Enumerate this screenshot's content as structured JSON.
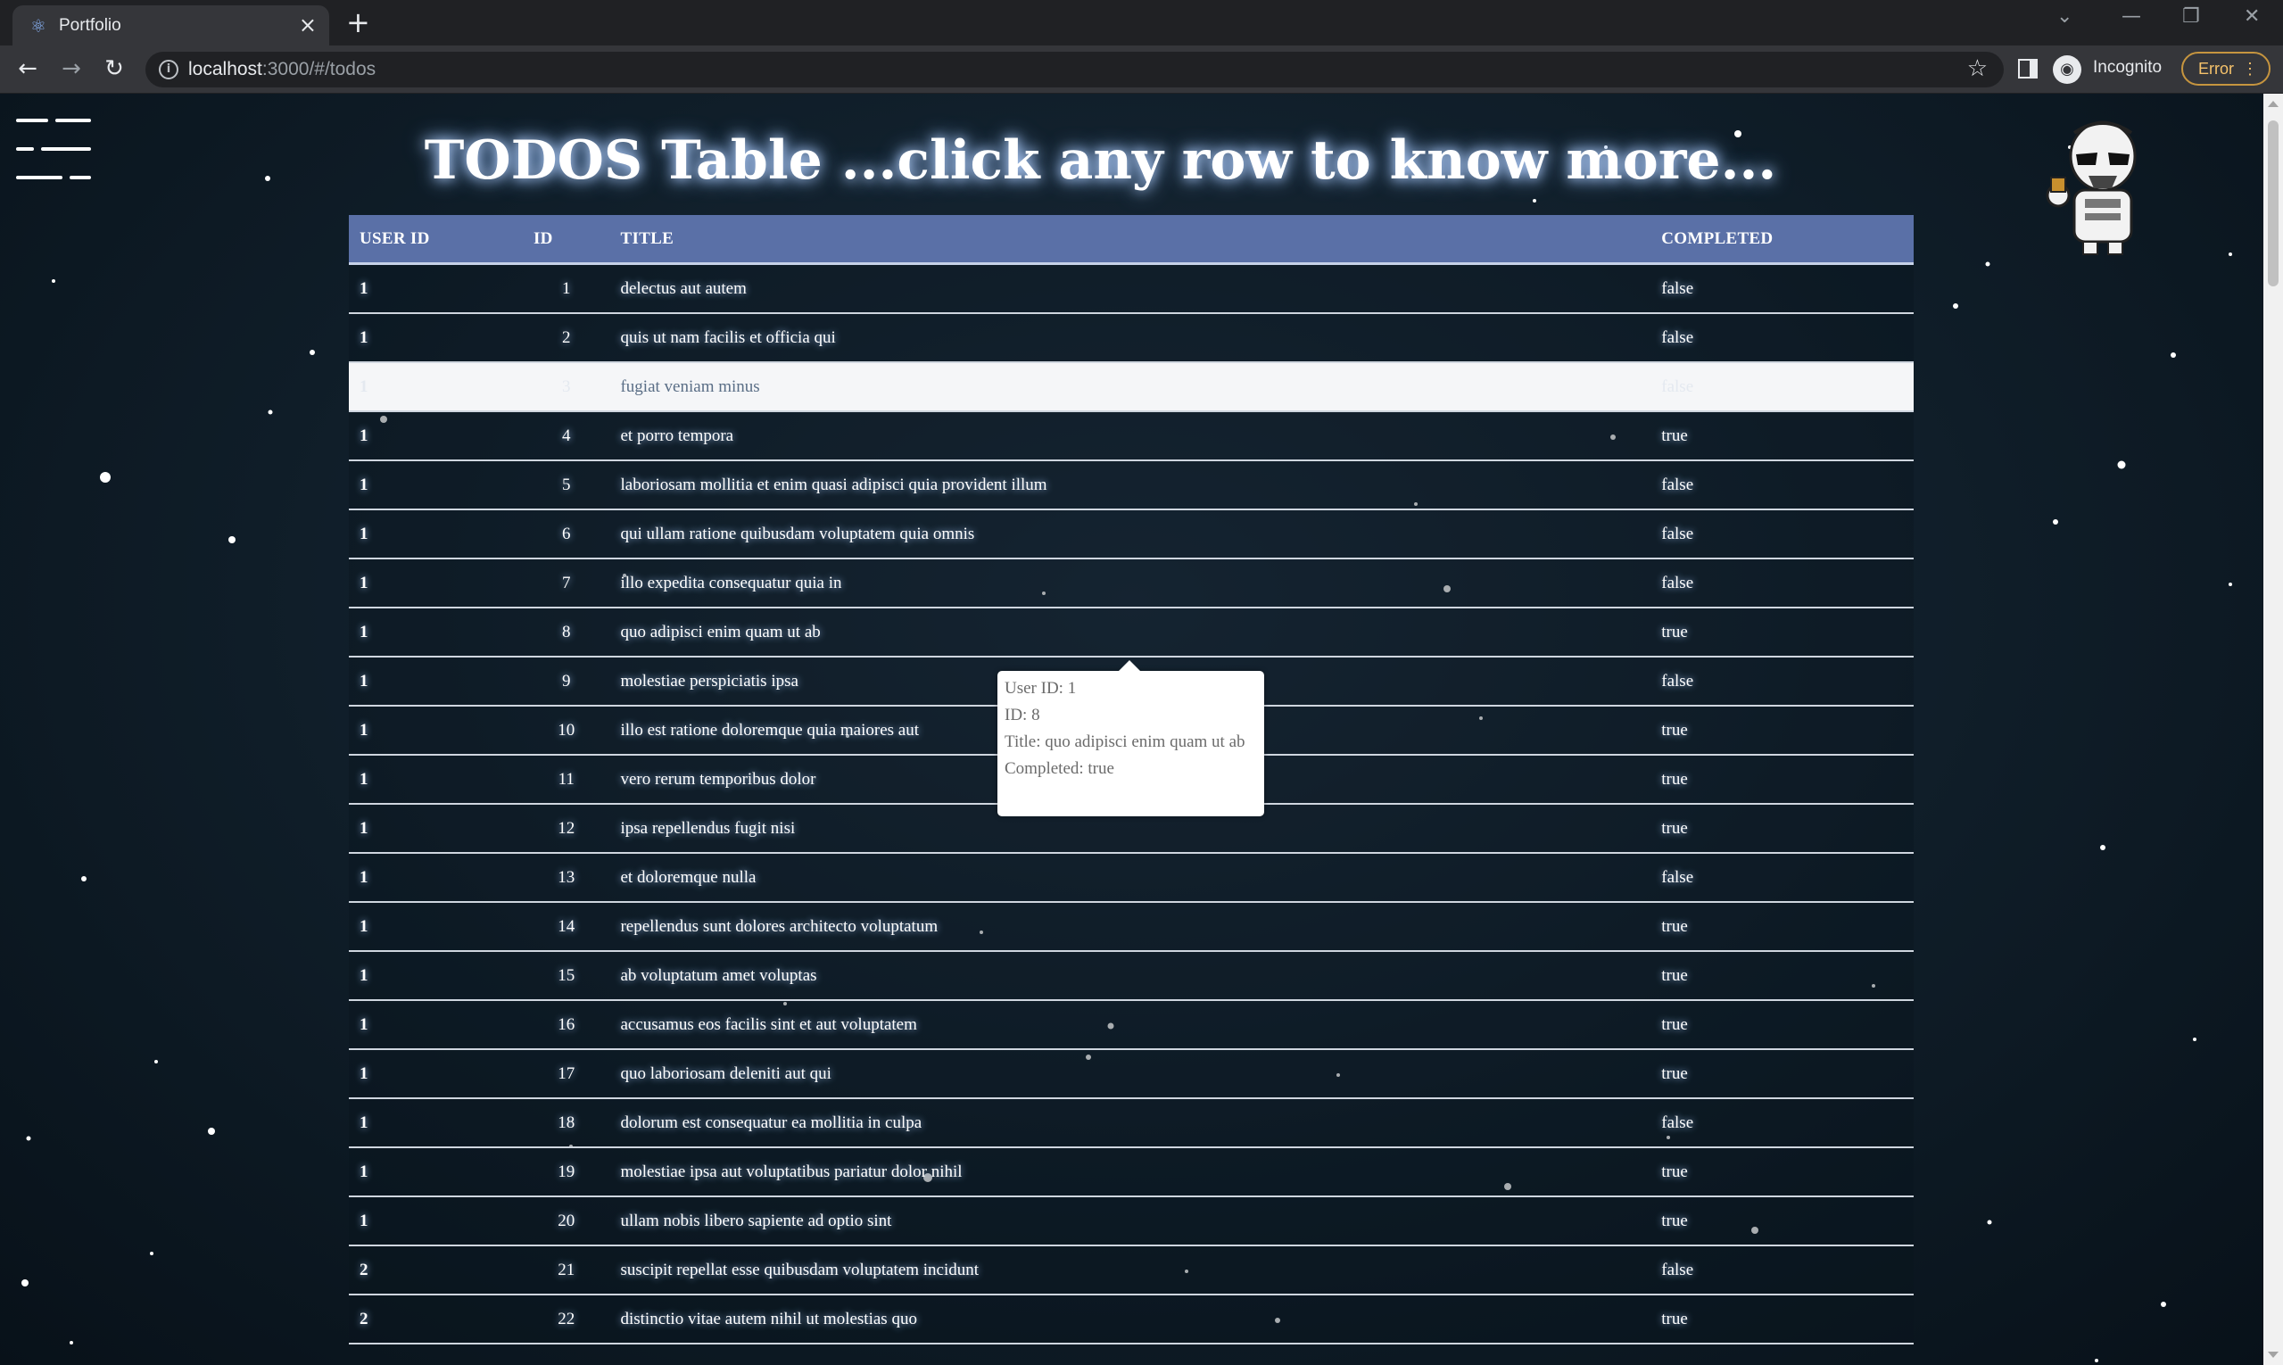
{
  "browser": {
    "tab_title": "Portfolio",
    "url_host": "localhost",
    "url_path": ":3000/#/todos",
    "profile_label": "Incognito",
    "error_label": "Error"
  },
  "page": {
    "heading": "TODOS Table ...click any row to know more...",
    "columns": [
      "USER ID",
      "ID",
      "TITLE",
      "COMPLETED"
    ],
    "rows": [
      {
        "user_id": "1",
        "id": "1",
        "title": "delectus aut autem",
        "completed": "false"
      },
      {
        "user_id": "1",
        "id": "2",
        "title": "quis ut nam facilis et officia qui",
        "completed": "false"
      },
      {
        "user_id": "1",
        "id": "3",
        "title": "fugiat veniam minus",
        "completed": "false"
      },
      {
        "user_id": "1",
        "id": "4",
        "title": "et porro tempora",
        "completed": "true"
      },
      {
        "user_id": "1",
        "id": "5",
        "title": "laboriosam mollitia et enim quasi adipisci quia provident illum",
        "completed": "false"
      },
      {
        "user_id": "1",
        "id": "6",
        "title": "qui ullam ratione quibusdam voluptatem quia omnis",
        "completed": "false"
      },
      {
        "user_id": "1",
        "id": "7",
        "title": "illo expedita consequatur quia in",
        "completed": "false"
      },
      {
        "user_id": "1",
        "id": "8",
        "title": "quo adipisci enim quam ut ab",
        "completed": "true"
      },
      {
        "user_id": "1",
        "id": "9",
        "title": "molestiae perspiciatis ipsa",
        "completed": "false"
      },
      {
        "user_id": "1",
        "id": "10",
        "title": "illo est ratione doloremque quia maiores aut",
        "completed": "true"
      },
      {
        "user_id": "1",
        "id": "11",
        "title": "vero rerum temporibus dolor",
        "completed": "true"
      },
      {
        "user_id": "1",
        "id": "12",
        "title": "ipsa repellendus fugit nisi",
        "completed": "true"
      },
      {
        "user_id": "1",
        "id": "13",
        "title": "et doloremque nulla",
        "completed": "false"
      },
      {
        "user_id": "1",
        "id": "14",
        "title": "repellendus sunt dolores architecto voluptatum",
        "completed": "true"
      },
      {
        "user_id": "1",
        "id": "15",
        "title": "ab voluptatum amet voluptas",
        "completed": "true"
      },
      {
        "user_id": "1",
        "id": "16",
        "title": "accusamus eos facilis sint et aut voluptatem",
        "completed": "true"
      },
      {
        "user_id": "1",
        "id": "17",
        "title": "quo laboriosam deleniti aut qui",
        "completed": "true"
      },
      {
        "user_id": "1",
        "id": "18",
        "title": "dolorum est consequatur ea mollitia in culpa",
        "completed": "false"
      },
      {
        "user_id": "1",
        "id": "19",
        "title": "molestiae ipsa aut voluptatibus pariatur dolor nihil",
        "completed": "true"
      },
      {
        "user_id": "1",
        "id": "20",
        "title": "ullam nobis libero sapiente ad optio sint",
        "completed": "true"
      },
      {
        "user_id": "2",
        "id": "21",
        "title": "suscipit repellat esse quibusdam voluptatem incidunt",
        "completed": "false"
      },
      {
        "user_id": "2",
        "id": "22",
        "title": "distinctio vitae autem nihil ut molestias quo",
        "completed": "true"
      }
    ],
    "highlighted_row": 2,
    "tooltip": {
      "user_id": "User ID: 1",
      "id": "ID: 8",
      "title": "Title: quo adipisci enim quam ut ab",
      "completed": "Completed: true"
    }
  },
  "colors": {
    "header_bg": "#5a70a7",
    "error_accent": "#c6953f"
  }
}
